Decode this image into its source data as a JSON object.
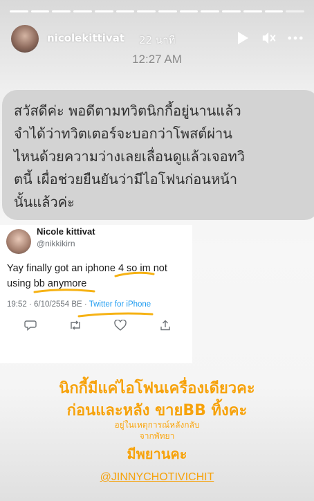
{
  "story": {
    "segments_total": 14,
    "segments_viewed": 13
  },
  "header": {
    "username": "nicolekittivat",
    "age": "22 นาที"
  },
  "timestamp": "12:27 AM",
  "bubble": {
    "lines": [
      "สวัสดีค่ะ พอดีตามทวิตนิกกี้อยู่นานแล้ว",
      "จำได้ว่าทวิตเตอร์จะบอกว่าโพสต์ผ่าน",
      "ไหนด้วยความว่างเลยเลื่อนดูแล้วเจอทวิ",
      "ตนี้ เผื่อช่วยยืนยันว่ามีไอโฟนก่อนหน้า",
      "นั้นแล้วค่ะ"
    ]
  },
  "tweet": {
    "name": "Nicole kittivat",
    "handle": "@nikkikirn",
    "text_line1": "Yay finally got an iphone 4 so im not",
    "text_line2": "using bb anymore",
    "date": "19:52 · 6/10/2554 BE · ",
    "source": "Twitter for iPhone"
  },
  "overlay": {
    "line1": "นิกกี้มีแค่ไอโฟนเครื่องเดียวคะ",
    "line2": "ก่อนและหลัง ขายBB ทิ้งคะ",
    "line3": "อยู่ในเหตุการณ์หลังกลับ",
    "line4": "จากพัทยา",
    "line5": "มีพยานคะ",
    "mention": "@JINNYCHOTIVICHIT"
  },
  "colors": {
    "overlay_text": "#f6a20b",
    "tweet_link": "#1d9bf0",
    "bubble_bg": "#d3d3d3"
  },
  "icons": [
    "play-icon",
    "mute-icon",
    "more-icon",
    "reply-icon",
    "retweet-icon",
    "like-icon",
    "share-icon"
  ]
}
